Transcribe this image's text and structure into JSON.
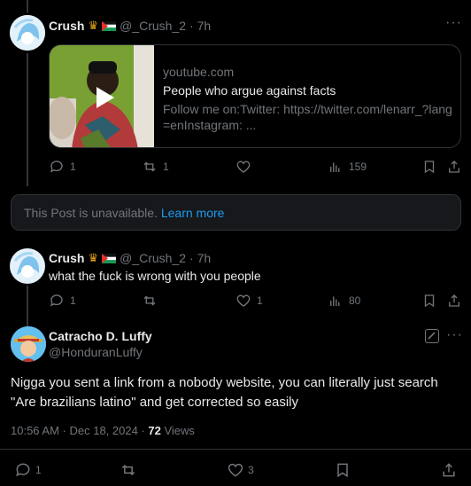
{
  "tweet1": {
    "name": "Crush",
    "handle": "@_Crush_2",
    "time": "· 7h",
    "card": {
      "domain": "youtube.com",
      "title": "People who argue against facts",
      "description": "Follow me on:Twitter: https://twitter.com/lenarr_?lang=enInstagram: ..."
    },
    "actions": {
      "replies": "1",
      "reposts": "1",
      "likes": "",
      "views": "159"
    }
  },
  "unavailable": {
    "text": "This Post is unavailable.",
    "link": "Learn more"
  },
  "tweet2": {
    "name": "Crush",
    "handle": "@_Crush_2",
    "time": "· 7h",
    "text": "what the fuck is wrong with you people",
    "actions": {
      "replies": "1",
      "reposts": "",
      "likes": "1",
      "views": "80"
    }
  },
  "main": {
    "name": "Catracho D. Luffy",
    "handle": "@HonduranLuffy",
    "text_line1": "Nigga you sent a link from a nobody website, you can literally just search",
    "text_line2": "\"Are brazilians latino\" and get corrected so easily",
    "timestamp": "10:56 AM · Dec 18, 2024 · ",
    "views_count": "72",
    "views_label": " Views",
    "actions": {
      "replies": "1",
      "reposts": "",
      "likes": "3"
    }
  },
  "colors": {
    "accent": "#1d9bf0",
    "muted": "#71767b",
    "text": "#e7e9ea",
    "border": "#2f3336"
  }
}
